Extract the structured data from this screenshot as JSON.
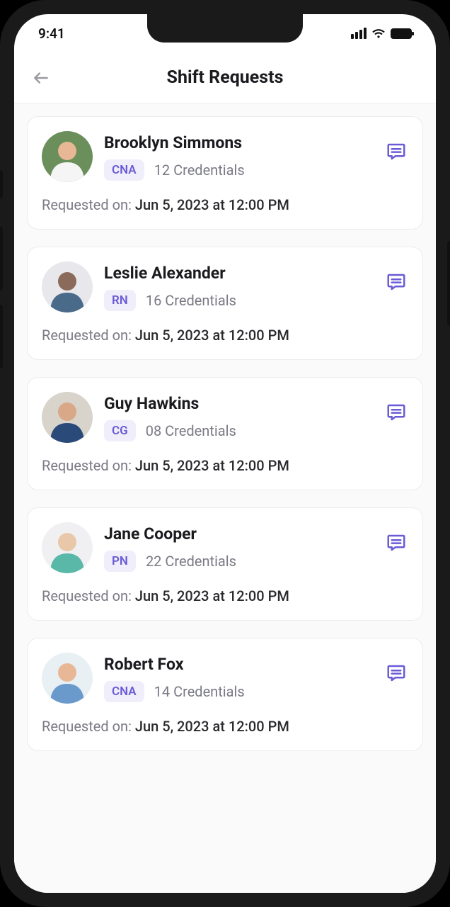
{
  "status": {
    "time": "9:41"
  },
  "header": {
    "title": "Shift Requests"
  },
  "labels": {
    "requested_on": "Requested on: "
  },
  "requests": [
    {
      "name": "Brooklyn Simmons",
      "role": "CNA",
      "credentials": "12 Credentials",
      "requested_date": "Jun 5, 2023 at 12:00 PM",
      "avatar_bg": "#6a8f5a",
      "avatar_shirt": "#f5f5f5",
      "avatar_skin": "#e8b896"
    },
    {
      "name": "Leslie Alexander",
      "role": "RN",
      "credentials": "16 Credentials",
      "requested_date": "Jun 5, 2023 at 12:00 PM",
      "avatar_bg": "#e8e8ec",
      "avatar_shirt": "#4a6a8a",
      "avatar_skin": "#8a6a5a"
    },
    {
      "name": "Guy Hawkins",
      "role": "CG",
      "credentials": "08 Credentials",
      "requested_date": "Jun 5, 2023 at 12:00 PM",
      "avatar_bg": "#d8d4cc",
      "avatar_shirt": "#2a4a7a",
      "avatar_skin": "#d8a888"
    },
    {
      "name": "Jane Cooper",
      "role": "PN",
      "credentials": "22 Credentials",
      "requested_date": "Jun 5, 2023 at 12:00 PM",
      "avatar_bg": "#f0f0f2",
      "avatar_shirt": "#5ab8a8",
      "avatar_skin": "#e8c8a8"
    },
    {
      "name": "Robert Fox",
      "role": "CNA",
      "credentials": "14 Credentials",
      "requested_date": "Jun 5, 2023 at 12:00 PM",
      "avatar_bg": "#e8f0f4",
      "avatar_shirt": "#6a9acc",
      "avatar_skin": "#e8b896"
    }
  ]
}
